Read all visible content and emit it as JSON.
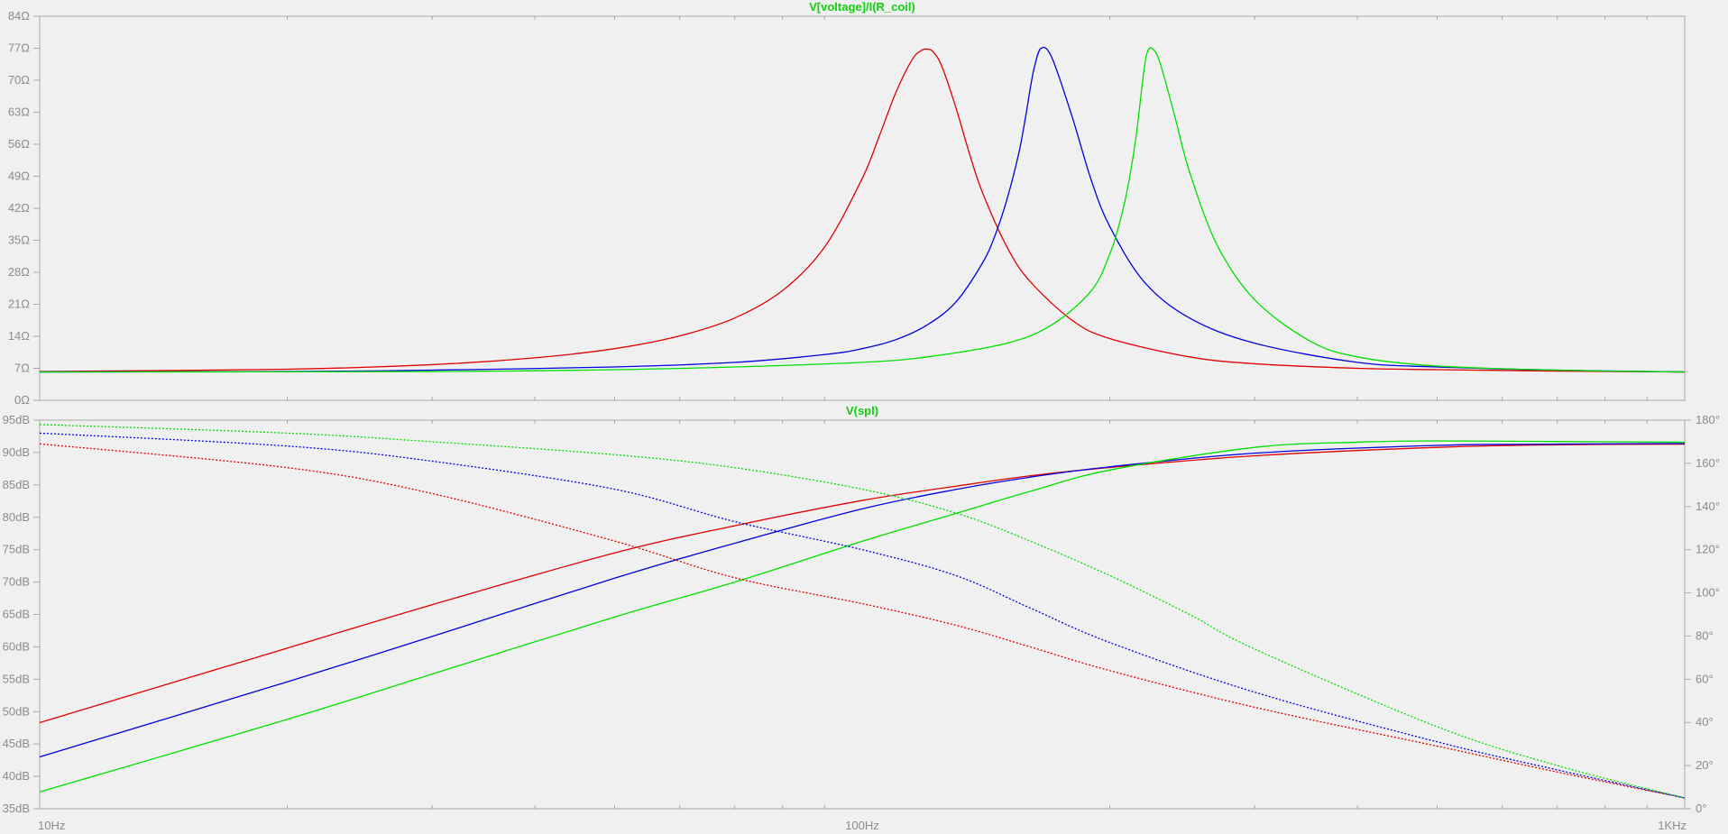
{
  "colors": {
    "background": "#f0f0f0",
    "plot_frame": "#a8a8a8",
    "tick_text": "#8c8c8c",
    "title": "#10d010",
    "series_red": "#e00000",
    "series_blue": "#0000e0",
    "series_green": "#00e000"
  },
  "chart_data": [
    {
      "type": "line",
      "title": "V[voltage]/I(R_coil)",
      "xscale": "log",
      "xlim": [
        10,
        1000
      ],
      "xticks": [
        {
          "value": 10,
          "label": "10Hz"
        },
        {
          "value": 100,
          "label": "100Hz"
        },
        {
          "value": 1000,
          "label": "1KHz"
        }
      ],
      "ylim": [
        0,
        84
      ],
      "yticks": [
        {
          "value": 0,
          "label": "0Ω"
        },
        {
          "value": 7,
          "label": "7Ω"
        },
        {
          "value": 14,
          "label": "14Ω"
        },
        {
          "value": 21,
          "label": "21Ω"
        },
        {
          "value": 28,
          "label": "28Ω"
        },
        {
          "value": 35,
          "label": "35Ω"
        },
        {
          "value": 42,
          "label": "42Ω"
        },
        {
          "value": 49,
          "label": "49Ω"
        },
        {
          "value": 56,
          "label": "56Ω"
        },
        {
          "value": 63,
          "label": "63Ω"
        },
        {
          "value": 70,
          "label": "70Ω"
        },
        {
          "value": 77,
          "label": "77Ω"
        },
        {
          "value": 84,
          "label": "84Ω"
        }
      ],
      "series": [
        {
          "color": "#e00000",
          "style": "solid",
          "axis": "left",
          "x": [
            10,
            20,
            30,
            40,
            50,
            60,
            70,
            80,
            90,
            100,
            105,
            110,
            115,
            118,
            120,
            122,
            125,
            130,
            135,
            140,
            150,
            160,
            180,
            200,
            250,
            300,
            400,
            500,
            700,
            1000
          ],
          "y": [
            6.3,
            6.8,
            7.8,
            9.3,
            11.3,
            14.1,
            18.0,
            24.0,
            33.5,
            48.5,
            58.0,
            67.5,
            74.5,
            76.5,
            76.8,
            76.2,
            73.0,
            64.0,
            54.0,
            45.5,
            33.5,
            26.0,
            17.5,
            13.5,
            9.5,
            8.0,
            7.0,
            6.7,
            6.4,
            6.2
          ]
        },
        {
          "color": "#0000e0",
          "style": "solid",
          "axis": "left",
          "x": [
            10,
            20,
            30,
            50,
            70,
            90,
            100,
            110,
            120,
            130,
            140,
            145,
            150,
            155,
            158,
            160,
            162,
            165,
            170,
            180,
            190,
            200,
            220,
            250,
            300,
            400,
            500,
            700,
            1000
          ],
          "y": [
            6.2,
            6.3,
            6.6,
            7.3,
            8.3,
            10.0,
            11.3,
            13.3,
            16.5,
            21.5,
            30.0,
            36.0,
            44.0,
            54.0,
            62.0,
            68.0,
            73.0,
            77.0,
            75.0,
            62.0,
            48.0,
            38.0,
            26.0,
            18.0,
            12.5,
            8.3,
            7.3,
            6.6,
            6.2
          ]
        },
        {
          "color": "#00e000",
          "style": "solid",
          "axis": "left",
          "x": [
            10,
            30,
            50,
            70,
            100,
            120,
            150,
            170,
            190,
            200,
            205,
            210,
            215,
            218,
            220,
            222,
            225,
            230,
            240,
            250,
            270,
            300,
            350,
            400,
            500,
            700,
            1000
          ],
          "y": [
            6.2,
            6.3,
            6.7,
            7.3,
            8.3,
            9.5,
            12.5,
            16.5,
            24.0,
            32.0,
            38.0,
            46.0,
            57.0,
            66.0,
            72.0,
            76.0,
            77.0,
            74.0,
            62.0,
            50.0,
            34.0,
            22.0,
            13.0,
            9.5,
            7.5,
            6.6,
            6.2
          ]
        }
      ]
    },
    {
      "type": "line",
      "title": "V(spl)",
      "xscale": "log",
      "xlim": [
        10,
        1000
      ],
      "xticks": [
        {
          "value": 10,
          "label": "10Hz"
        },
        {
          "value": 100,
          "label": "100Hz"
        },
        {
          "value": 1000,
          "label": "1KHz"
        }
      ],
      "ylim": [
        35,
        95
      ],
      "y2lim": [
        0,
        180
      ],
      "yticks": [
        {
          "value": 35,
          "label": "35dB"
        },
        {
          "value": 40,
          "label": "40dB"
        },
        {
          "value": 45,
          "label": "45dB"
        },
        {
          "value": 50,
          "label": "50dB"
        },
        {
          "value": 55,
          "label": "55dB"
        },
        {
          "value": 60,
          "label": "60dB"
        },
        {
          "value": 65,
          "label": "65dB"
        },
        {
          "value": 70,
          "label": "70dB"
        },
        {
          "value": 75,
          "label": "75dB"
        },
        {
          "value": 80,
          "label": "80dB"
        },
        {
          "value": 85,
          "label": "85dB"
        },
        {
          "value": 90,
          "label": "90dB"
        },
        {
          "value": 95,
          "label": "95dB"
        }
      ],
      "y2ticks": [
        {
          "value": 0,
          "label": "0°"
        },
        {
          "value": 20,
          "label": "20°"
        },
        {
          "value": 40,
          "label": "40°"
        },
        {
          "value": 60,
          "label": "60°"
        },
        {
          "value": 80,
          "label": "80°"
        },
        {
          "value": 100,
          "label": "100°"
        },
        {
          "value": 120,
          "label": "120°"
        },
        {
          "value": 140,
          "label": "140°"
        },
        {
          "value": 160,
          "label": "160°"
        },
        {
          "value": 180,
          "label": "180°"
        }
      ],
      "series": [
        {
          "color": "#e00000",
          "style": "solid",
          "axis": "left",
          "x": [
            10,
            20,
            30,
            50,
            70,
            100,
            130,
            160,
            200,
            300,
            500,
            700,
            1000
          ],
          "y": [
            48.3,
            59.8,
            66.5,
            74.5,
            78.7,
            82.6,
            84.8,
            86.4,
            87.7,
            89.5,
            90.8,
            91.2,
            91.3
          ]
        },
        {
          "color": "#0000e0",
          "style": "solid",
          "axis": "left",
          "x": [
            10,
            20,
            30,
            50,
            70,
            100,
            130,
            160,
            200,
            300,
            500,
            700,
            1000
          ],
          "y": [
            43.0,
            54.6,
            61.6,
            70.6,
            76.0,
            81.3,
            84.3,
            86.2,
            87.8,
            89.9,
            91.1,
            91.3,
            91.4
          ]
        },
        {
          "color": "#00e000",
          "style": "solid",
          "axis": "left",
          "x": [
            10,
            20,
            30,
            50,
            70,
            100,
            130,
            160,
            200,
            300,
            400,
            500,
            700,
            1000
          ],
          "y": [
            37.6,
            48.8,
            55.8,
            64.6,
            70.0,
            76.3,
            80.6,
            84.0,
            87.3,
            90.8,
            91.6,
            91.8,
            91.7,
            91.6
          ]
        },
        {
          "color": "#e00000",
          "style": "dotted",
          "axis": "right",
          "x": [
            10,
            20,
            30,
            50,
            70,
            100,
            130,
            160,
            200,
            300,
            500,
            700,
            1000
          ],
          "y": [
            169.0,
            158.0,
            146.0,
            124.0,
            107.0,
            95.0,
            85.0,
            75.0,
            64.0,
            47.0,
            29.0,
            17.0,
            5.0
          ]
        },
        {
          "color": "#0000e0",
          "style": "dotted",
          "axis": "right",
          "x": [
            10,
            20,
            30,
            50,
            70,
            100,
            130,
            160,
            200,
            300,
            500,
            700,
            1000
          ],
          "y": [
            174.0,
            168.0,
            161.0,
            148.0,
            133.0,
            120.0,
            108.0,
            93.0,
            77.0,
            54.0,
            31.0,
            18.0,
            5.0
          ]
        },
        {
          "color": "#00e000",
          "style": "dotted",
          "axis": "right",
          "x": [
            10,
            20,
            30,
            50,
            70,
            100,
            130,
            160,
            200,
            250,
            300,
            500,
            700,
            1000
          ],
          "y": [
            178.0,
            174.0,
            170.0,
            164.0,
            158.0,
            148.0,
            137.0,
            124.0,
            108.0,
            90.0,
            74.0,
            38.0,
            20.0,
            5.0
          ]
        }
      ]
    }
  ]
}
